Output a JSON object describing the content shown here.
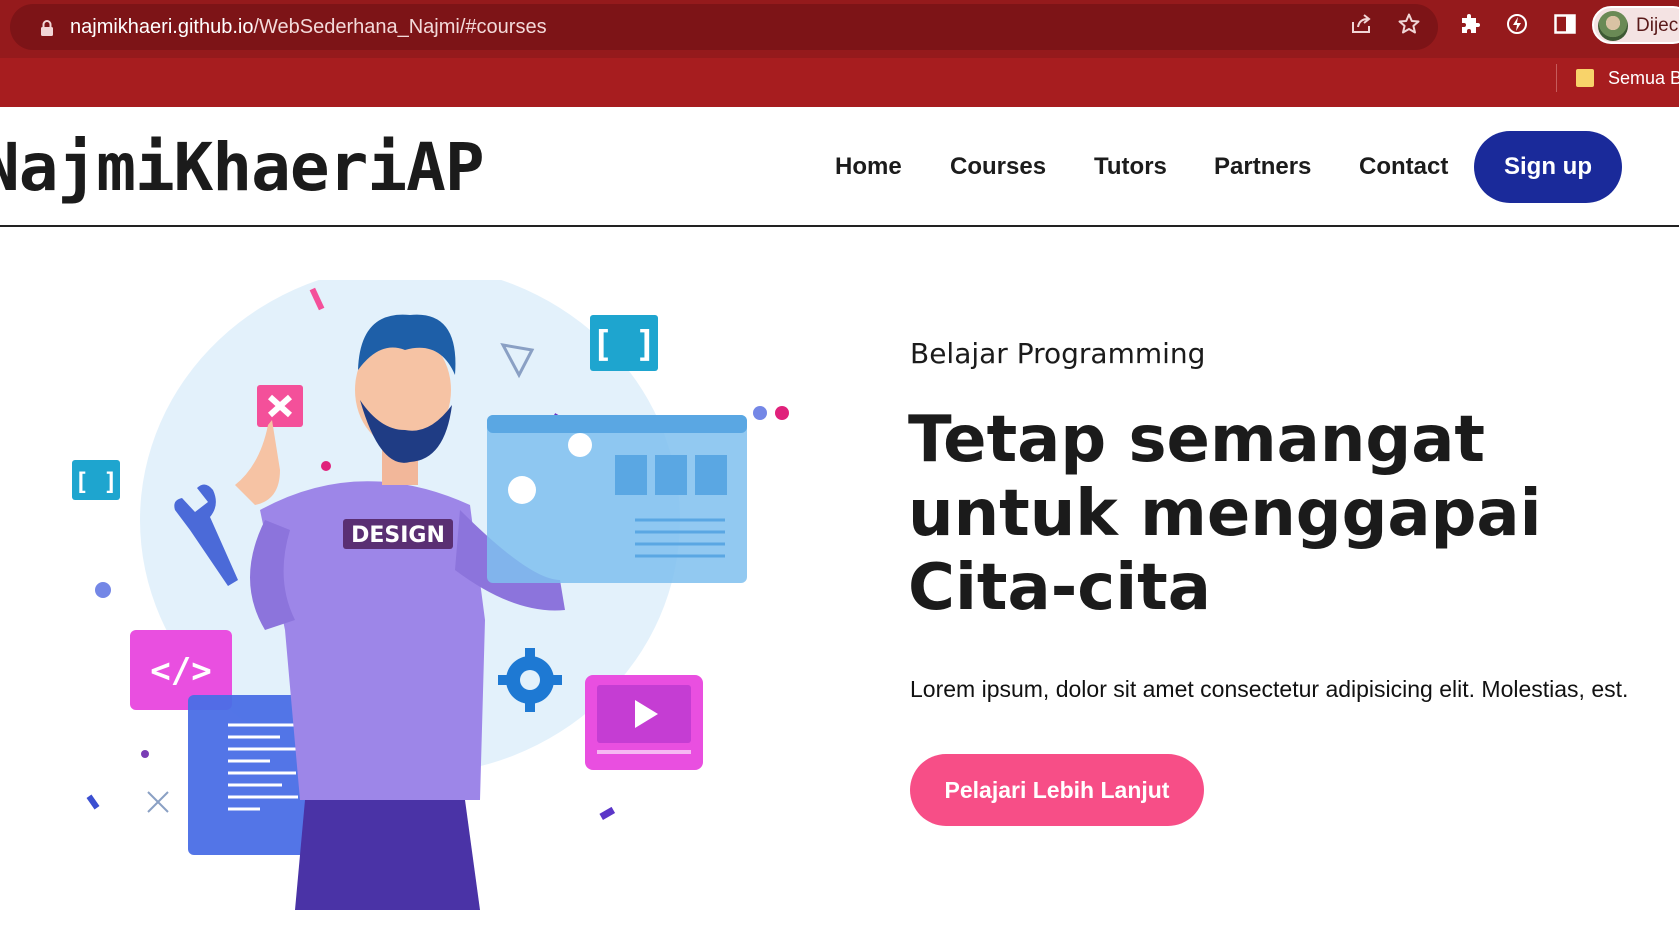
{
  "browser": {
    "url_host": "najmikhaeri.github.io",
    "url_path": "/WebSederhana_Najmi/#courses",
    "profile_name": "Dijec",
    "bookmark_label": "Semua B",
    "colors": {
      "frame": "#a71d1f",
      "omnibox": "#7d1417"
    },
    "icons": [
      "lock-icon",
      "share-icon",
      "star-icon",
      "extensions-icon",
      "performance-icon",
      "side-panel-icon",
      "avatar",
      "bookmark-folder-icon"
    ]
  },
  "site": {
    "logo": "NajmiKhaeriAP",
    "nav": {
      "home": "Home",
      "courses": "Courses",
      "tutors": "Tutors",
      "partners": "Partners",
      "contact": "Contact",
      "signup": "Sign up"
    },
    "hero": {
      "eyebrow": "Belajar Programming",
      "headline": "Tetap semangat untuk menggapai Cita-cita",
      "body": "Lorem ipsum, dolor sit amet consectetur adipisicing elit. Molestias, est.",
      "cta": "Pelajari Lebih Lanjut",
      "shirt_text": "DESIGN"
    },
    "colors": {
      "signup": "#1a2a9a",
      "cta": "#f74e87",
      "text": "#1b1b1b"
    }
  }
}
